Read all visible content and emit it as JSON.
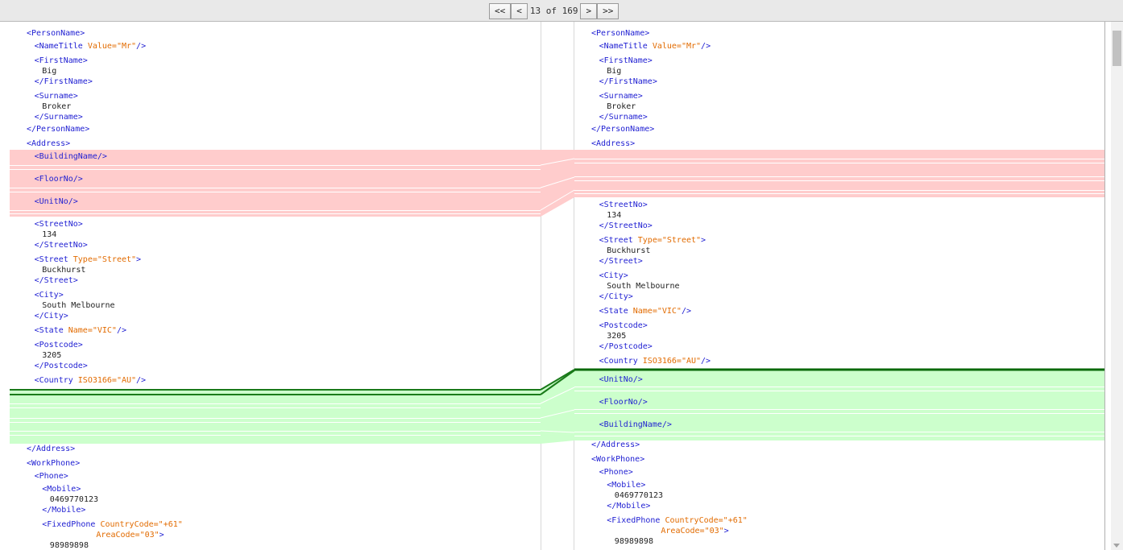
{
  "nav": {
    "first_label": "<<",
    "prev_label": "<",
    "counter": "13 of 169",
    "next_label": ">",
    "last_label": ">>"
  },
  "colors": {
    "removed": "#ffcccc",
    "added": "#ccffcc",
    "added_line": "#008000",
    "tag": "#1e1ed2",
    "attribute": "#e26b00"
  },
  "left_pane": [
    {
      "indent": 0,
      "parts": [
        {
          "t": "<PersonName>",
          "c": "tag"
        }
      ]
    },
    {
      "indent": 1,
      "parts": [
        {
          "t": "<NameTitle ",
          "c": "tag"
        },
        {
          "t": "Value=\"Mr\"",
          "c": "attr"
        },
        {
          "t": "/>",
          "c": "tag"
        }
      ]
    },
    {
      "indent": 1,
      "parts": [
        {
          "t": "<FirstName>",
          "c": "tag"
        }
      ]
    },
    {
      "indent": 2,
      "parts": [
        {
          "t": "Big",
          "c": "txt"
        }
      ]
    },
    {
      "indent": 1,
      "parts": [
        {
          "t": "</FirstName>",
          "c": "tag"
        }
      ]
    },
    {
      "indent": 1,
      "parts": [
        {
          "t": "<Surname>",
          "c": "tag"
        }
      ]
    },
    {
      "indent": 2,
      "parts": [
        {
          "t": "Broker",
          "c": "txt"
        }
      ]
    },
    {
      "indent": 1,
      "parts": [
        {
          "t": "</Surname>",
          "c": "tag"
        }
      ]
    },
    {
      "indent": 0,
      "parts": [
        {
          "t": "</PersonName>",
          "c": "tag"
        }
      ]
    },
    {
      "indent": 0,
      "parts": [
        {
          "t": "<Address>",
          "c": "tag"
        }
      ]
    },
    {
      "indent": 1,
      "parts": [
        {
          "t": "<BuildingName/>",
          "c": "tag"
        }
      ]
    },
    {
      "indent": 1,
      "parts": [
        {
          "t": "<FloorNo/>",
          "c": "tag"
        }
      ]
    },
    {
      "indent": 1,
      "parts": [
        {
          "t": "<UnitNo/>",
          "c": "tag"
        }
      ]
    },
    {
      "indent": 1,
      "parts": [
        {
          "t": "<StreetNo>",
          "c": "tag"
        }
      ]
    },
    {
      "indent": 2,
      "parts": [
        {
          "t": "134",
          "c": "txt"
        }
      ]
    },
    {
      "indent": 1,
      "parts": [
        {
          "t": "</StreetNo>",
          "c": "tag"
        }
      ]
    },
    {
      "indent": 1,
      "parts": [
        {
          "t": "<Street ",
          "c": "tag"
        },
        {
          "t": "Type=\"Street\"",
          "c": "attr"
        },
        {
          "t": ">",
          "c": "tag"
        }
      ]
    },
    {
      "indent": 2,
      "parts": [
        {
          "t": "Buckhurst",
          "c": "txt"
        }
      ]
    },
    {
      "indent": 1,
      "parts": [
        {
          "t": "</Street>",
          "c": "tag"
        }
      ]
    },
    {
      "indent": 1,
      "parts": [
        {
          "t": "<City>",
          "c": "tag"
        }
      ]
    },
    {
      "indent": 2,
      "parts": [
        {
          "t": "South Melbourne",
          "c": "txt"
        }
      ]
    },
    {
      "indent": 1,
      "parts": [
        {
          "t": "</City>",
          "c": "tag"
        }
      ]
    },
    {
      "indent": 1,
      "parts": [
        {
          "t": "<State ",
          "c": "tag"
        },
        {
          "t": "Name=\"VIC\"",
          "c": "attr"
        },
        {
          "t": "/>",
          "c": "tag"
        }
      ]
    },
    {
      "indent": 1,
      "parts": [
        {
          "t": "<Postcode>",
          "c": "tag"
        }
      ]
    },
    {
      "indent": 2,
      "parts": [
        {
          "t": "3205",
          "c": "txt"
        }
      ]
    },
    {
      "indent": 1,
      "parts": [
        {
          "t": "</Postcode>",
          "c": "tag"
        }
      ]
    },
    {
      "indent": 1,
      "parts": [
        {
          "t": "<Country ",
          "c": "tag"
        },
        {
          "t": "ISO3166=\"AU\"",
          "c": "attr"
        },
        {
          "t": "/>",
          "c": "tag"
        }
      ]
    },
    {
      "indent": 0,
      "parts": [
        {
          "t": "</Address>",
          "c": "tag"
        }
      ]
    },
    {
      "indent": 0,
      "parts": [
        {
          "t": "<WorkPhone>",
          "c": "tag"
        }
      ]
    },
    {
      "indent": 1,
      "parts": [
        {
          "t": "<Phone>",
          "c": "tag"
        }
      ]
    },
    {
      "indent": 2,
      "parts": [
        {
          "t": "<Mobile>",
          "c": "tag"
        }
      ]
    },
    {
      "indent": 3,
      "parts": [
        {
          "t": "0469770123",
          "c": "txt"
        }
      ]
    },
    {
      "indent": 2,
      "parts": [
        {
          "t": "</Mobile>",
          "c": "tag"
        }
      ]
    },
    {
      "indent": 2,
      "parts": [
        {
          "t": "<FixedPhone ",
          "c": "tag"
        },
        {
          "t": "CountryCode=\"+61\"",
          "c": "attr"
        }
      ]
    },
    {
      "indent": 9,
      "parts": [
        {
          "t": "AreaCode=\"03\"",
          "c": "attr"
        },
        {
          "t": ">",
          "c": "tag"
        }
      ]
    },
    {
      "indent": 3,
      "parts": [
        {
          "t": "98989898",
          "c": "txt"
        }
      ]
    }
  ],
  "right_pane": [
    {
      "indent": 0,
      "parts": [
        {
          "t": "<PersonName>",
          "c": "tag"
        }
      ]
    },
    {
      "indent": 1,
      "parts": [
        {
          "t": "<NameTitle ",
          "c": "tag"
        },
        {
          "t": "Value=\"Mr\"",
          "c": "attr"
        },
        {
          "t": "/>",
          "c": "tag"
        }
      ]
    },
    {
      "indent": 1,
      "parts": [
        {
          "t": "<FirstName>",
          "c": "tag"
        }
      ]
    },
    {
      "indent": 2,
      "parts": [
        {
          "t": "Big",
          "c": "txt"
        }
      ]
    },
    {
      "indent": 1,
      "parts": [
        {
          "t": "</FirstName>",
          "c": "tag"
        }
      ]
    },
    {
      "indent": 1,
      "parts": [
        {
          "t": "<Surname>",
          "c": "tag"
        }
      ]
    },
    {
      "indent": 2,
      "parts": [
        {
          "t": "Broker",
          "c": "txt"
        }
      ]
    },
    {
      "indent": 1,
      "parts": [
        {
          "t": "</Surname>",
          "c": "tag"
        }
      ]
    },
    {
      "indent": 0,
      "parts": [
        {
          "t": "</PersonName>",
          "c": "tag"
        }
      ]
    },
    {
      "indent": 0,
      "parts": [
        {
          "t": "<Address>",
          "c": "tag"
        }
      ]
    },
    {
      "indent": 1,
      "parts": [
        {
          "t": "<StreetNo>",
          "c": "tag"
        }
      ]
    },
    {
      "indent": 2,
      "parts": [
        {
          "t": "134",
          "c": "txt"
        }
      ]
    },
    {
      "indent": 1,
      "parts": [
        {
          "t": "</StreetNo>",
          "c": "tag"
        }
      ]
    },
    {
      "indent": 1,
      "parts": [
        {
          "t": "<Street ",
          "c": "tag"
        },
        {
          "t": "Type=\"Street\"",
          "c": "attr"
        },
        {
          "t": ">",
          "c": "tag"
        }
      ]
    },
    {
      "indent": 2,
      "parts": [
        {
          "t": "Buckhurst",
          "c": "txt"
        }
      ]
    },
    {
      "indent": 1,
      "parts": [
        {
          "t": "</Street>",
          "c": "tag"
        }
      ]
    },
    {
      "indent": 1,
      "parts": [
        {
          "t": "<City>",
          "c": "tag"
        }
      ]
    },
    {
      "indent": 2,
      "parts": [
        {
          "t": "South Melbourne",
          "c": "txt"
        }
      ]
    },
    {
      "indent": 1,
      "parts": [
        {
          "t": "</City>",
          "c": "tag"
        }
      ]
    },
    {
      "indent": 1,
      "parts": [
        {
          "t": "<State ",
          "c": "tag"
        },
        {
          "t": "Name=\"VIC\"",
          "c": "attr"
        },
        {
          "t": "/>",
          "c": "tag"
        }
      ]
    },
    {
      "indent": 1,
      "parts": [
        {
          "t": "<Postcode>",
          "c": "tag"
        }
      ]
    },
    {
      "indent": 2,
      "parts": [
        {
          "t": "3205",
          "c": "txt"
        }
      ]
    },
    {
      "indent": 1,
      "parts": [
        {
          "t": "</Postcode>",
          "c": "tag"
        }
      ]
    },
    {
      "indent": 1,
      "parts": [
        {
          "t": "<Country ",
          "c": "tag"
        },
        {
          "t": "ISO3166=\"AU\"",
          "c": "attr"
        },
        {
          "t": "/>",
          "c": "tag"
        }
      ]
    },
    {
      "indent": 1,
      "parts": [
        {
          "t": "<UnitNo/>",
          "c": "tag"
        }
      ]
    },
    {
      "indent": 1,
      "parts": [
        {
          "t": "<FloorNo/>",
          "c": "tag"
        }
      ]
    },
    {
      "indent": 1,
      "parts": [
        {
          "t": "<BuildingName/>",
          "c": "tag"
        }
      ]
    },
    {
      "indent": 0,
      "parts": [
        {
          "t": "</Address>",
          "c": "tag"
        }
      ]
    },
    {
      "indent": 0,
      "parts": [
        {
          "t": "<WorkPhone>",
          "c": "tag"
        }
      ]
    },
    {
      "indent": 1,
      "parts": [
        {
          "t": "<Phone>",
          "c": "tag"
        }
      ]
    },
    {
      "indent": 2,
      "parts": [
        {
          "t": "<Mobile>",
          "c": "tag"
        }
      ]
    },
    {
      "indent": 3,
      "parts": [
        {
          "t": "0469770123",
          "c": "txt"
        }
      ]
    },
    {
      "indent": 2,
      "parts": [
        {
          "t": "</Mobile>",
          "c": "tag"
        }
      ]
    },
    {
      "indent": 2,
      "parts": [
        {
          "t": "<FixedPhone ",
          "c": "tag"
        },
        {
          "t": "CountryCode=\"+61\"",
          "c": "attr"
        }
      ]
    },
    {
      "indent": 9,
      "parts": [
        {
          "t": "AreaCode=\"03\"",
          "c": "attr"
        },
        {
          "t": ">",
          "c": "tag"
        }
      ]
    },
    {
      "indent": 3,
      "parts": [
        {
          "t": "98989898",
          "c": "txt"
        }
      ]
    }
  ]
}
